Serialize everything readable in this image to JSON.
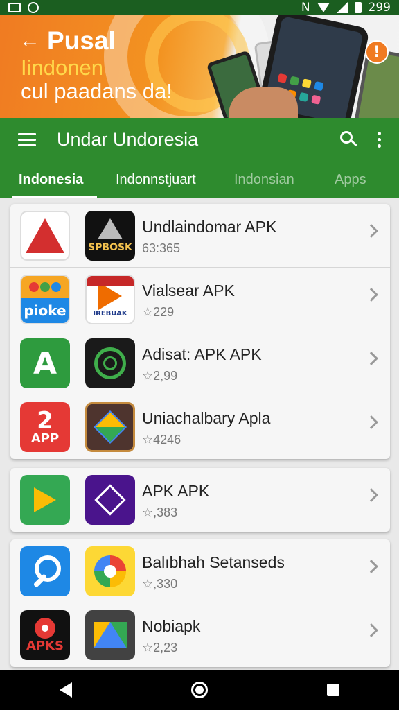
{
  "status_bar": {
    "carrier_letter": "N",
    "battery_text": "299"
  },
  "banner": {
    "title": "Pusal",
    "line2": "Iindonen",
    "line3": "cul paadans da!",
    "badge": "!"
  },
  "app_bar": {
    "title": "Undar Undoresia"
  },
  "tabs": [
    {
      "label": "Indonesia",
      "active": true
    },
    {
      "label": "Indonnstjuart",
      "active": false
    },
    {
      "label": "Indonsian",
      "active": false
    },
    {
      "label": "Apps",
      "active": false
    }
  ],
  "cards": [
    {
      "rows": [
        {
          "name": "Undlaindomar APK",
          "rating": "63:365",
          "icon1": "red-a-icon",
          "icon2": "spbosk-icon",
          "icon2_text": "SPBOSK"
        },
        {
          "name": "Vialsear APK",
          "rating": "☆229",
          "icon1": "pioke-icon",
          "icon1_text": "pioke",
          "icon2": "play-store-icon",
          "icon2_text": "IREBUAK"
        },
        {
          "name": "Adisat: APK APK",
          "rating": "☆2,99",
          "icon1": "green-a-icon",
          "icon2": "swirl-icon"
        },
        {
          "name": "Uniachalbary Apla",
          "rating": "☆4246",
          "icon1": "app-2-icon",
          "icon1_num": "2",
          "icon1_text": "APP",
          "icon2": "drive-diamond-icon"
        }
      ]
    },
    {
      "rows": [
        {
          "name": "APK APK",
          "rating": "☆,383",
          "icon1": "green-play-icon",
          "icon2": "purple-cube-icon"
        }
      ]
    },
    {
      "rows": [
        {
          "name": "Balıbhah Setanseds",
          "rating": "☆,330",
          "icon1": "blue-search-icon",
          "icon2": "yellow-pie-icon"
        },
        {
          "name": "Nobiapk",
          "rating": "☆2,23",
          "icon1": "apks-icon",
          "icon1_text": "APKS",
          "icon2": "gray-drive-icon"
        }
      ]
    }
  ],
  "colors": {
    "primary_green": "#2e8b2e",
    "status_green": "#1b5e20",
    "banner_orange": "#f07b22"
  }
}
